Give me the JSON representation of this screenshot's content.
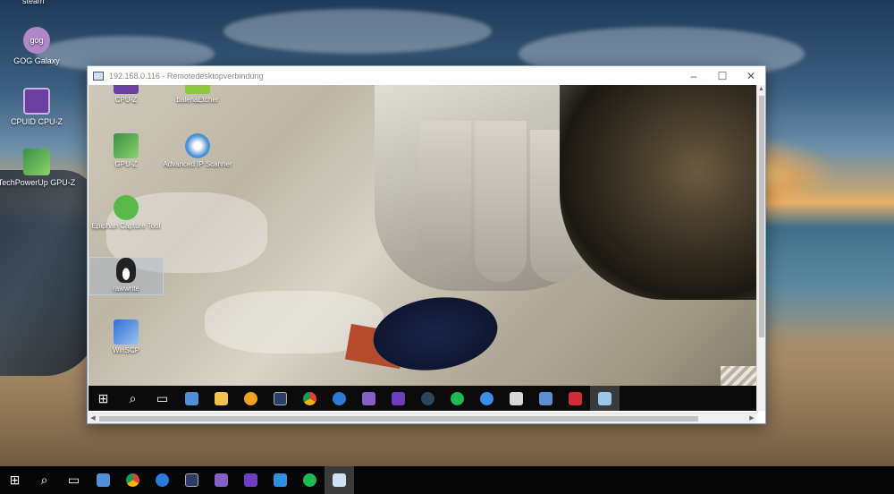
{
  "desktop": {
    "steam_label": "steam",
    "icons": [
      {
        "label": "GOG Galaxy",
        "icon": "gog-galaxy-icon",
        "color": "#b088c8"
      },
      {
        "label": "CPUID CPU-Z",
        "icon": "cpuz-icon",
        "color": "#6a3fa0"
      },
      {
        "label": "TechPowerUp GPU-Z",
        "icon": "gpuz-icon",
        "color": "#3a8f45"
      }
    ]
  },
  "remote_window": {
    "title": "192.168.0.116 - Remotedesktopverbindung",
    "controls": {
      "minimize": "–",
      "maximize": "☐",
      "close": "✕"
    },
    "icons": [
      {
        "label": "CPU-Z",
        "icon": "cpuz-icon",
        "color": "#6a3fa0"
      },
      {
        "label": "balenaEtcher",
        "icon": "balena-etcher-icon",
        "color": "#8dc63f"
      },
      {
        "label": "GPU-Z",
        "icon": "gpuz-icon",
        "color": "#3a8f45"
      },
      {
        "label": "Advanced IP Scanner",
        "icon": "advanced-ip-scanner-icon",
        "color": "#4d90d8"
      },
      {
        "label": "Epiphan Capture Tool",
        "icon": "epiphan-capture-icon",
        "color": "#58b848"
      },
      {
        "label": "rawwrite",
        "icon": "linux-penguin-icon",
        "color": "#222222"
      },
      {
        "label": "WinSCP",
        "icon": "winscp-icon",
        "color": "#2f6fd6"
      }
    ],
    "taskbar": [
      "start-icon",
      "search-icon",
      "task-view-icon",
      "remote-desktop-icon",
      "file-explorer-icon",
      "sun-app-icon",
      "powershell-icon",
      "chrome-icon",
      "cloud-app-icon",
      "visual-studio-icon",
      "visual-studio-icon",
      "steam-icon",
      "spotify-icon",
      "teamviewer-icon",
      "printer-icon",
      "virtualbox-icon",
      "capture-app-icon",
      "active-window-icon"
    ]
  },
  "main_taskbar": [
    "start-icon",
    "search-icon",
    "task-view-icon",
    "remote-desktop-icon",
    "chrome-icon",
    "cloud-app-icon",
    "powershell-icon",
    "visual-studio-icon",
    "visual-studio-icon",
    "vscode-icon",
    "spotify-icon",
    "remote-connection-icon"
  ],
  "colors": {
    "taskbar": "#050505",
    "window_border": "#8aa1b8"
  }
}
